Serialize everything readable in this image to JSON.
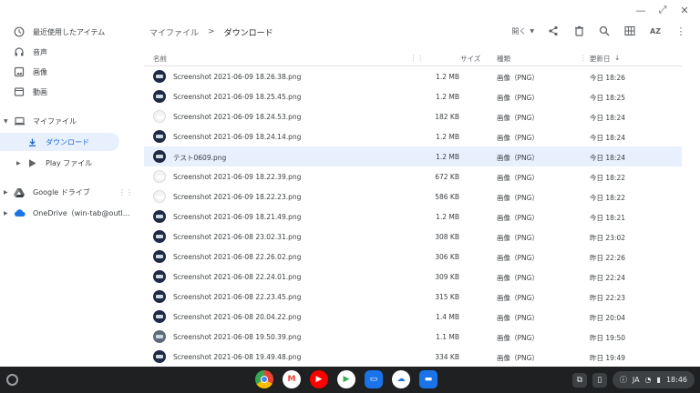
{
  "window_controls": [
    "—",
    "⤢",
    "✕"
  ],
  "sidebar": {
    "recent": "最近使用したアイテム",
    "audio": "音声",
    "images": "画像",
    "videos": "動画",
    "my_files": "マイファイル",
    "downloads": "ダウンロード",
    "play_files": "Play ファイル",
    "google_drive": "Google ドライブ",
    "onedrive": "OneDrive（win-tab@outl..."
  },
  "header": {
    "crumb_root": "マイファイル",
    "crumb_sep": ">",
    "crumb_current": "ダウンロード",
    "open_label": "開く"
  },
  "columns": {
    "name": "名前",
    "size": "サイズ",
    "type": "種類",
    "modified": "更新日"
  },
  "files": [
    {
      "name": "Screenshot 2021-06-09 18.26.38.png",
      "size": "1.2 MB",
      "type": "画像（PNG）",
      "date": "今日 18:26"
    },
    {
      "name": "Screenshot 2021-06-09 18.25.45.png",
      "size": "1.2 MB",
      "type": "画像（PNG）",
      "date": "今日 18:25"
    },
    {
      "name": "Screenshot 2021-06-09 18.24.53.png",
      "size": "182 KB",
      "type": "画像（PNG）",
      "date": "今日 18:24"
    },
    {
      "name": "Screenshot 2021-06-09 18.24.14.png",
      "size": "1.2 MB",
      "type": "画像（PNG）",
      "date": "今日 18:24"
    },
    {
      "name": "テスト0609.png",
      "size": "1.2 MB",
      "type": "画像（PNG）",
      "date": "今日 18:24"
    },
    {
      "name": "Screenshot 2021-06-09 18.22.39.png",
      "size": "672 KB",
      "type": "画像（PNG）",
      "date": "今日 18:22"
    },
    {
      "name": "Screenshot 2021-06-09 18.22.23.png",
      "size": "586 KB",
      "type": "画像（PNG）",
      "date": "今日 18:22"
    },
    {
      "name": "Screenshot 2021-06-09 18.21.49.png",
      "size": "1.2 MB",
      "type": "画像（PNG）",
      "date": "今日 18:21"
    },
    {
      "name": "Screenshot 2021-06-08 23.02.31.png",
      "size": "308 KB",
      "type": "画像（PNG）",
      "date": "昨日 23:02"
    },
    {
      "name": "Screenshot 2021-06-08 22.26.02.png",
      "size": "306 KB",
      "type": "画像（PNG）",
      "date": "昨日 22:26"
    },
    {
      "name": "Screenshot 2021-06-08 22.24.01.png",
      "size": "309 KB",
      "type": "画像（PNG）",
      "date": "昨日 22:24"
    },
    {
      "name": "Screenshot 2021-06-08 22.23.45.png",
      "size": "315 KB",
      "type": "画像（PNG）",
      "date": "昨日 22:23"
    },
    {
      "name": "Screenshot 2021-06-08 20.04.22.png",
      "size": "1.4 MB",
      "type": "画像（PNG）",
      "date": "昨日 20:04"
    },
    {
      "name": "Screenshot 2021-06-08 19.50.39.png",
      "size": "1.1 MB",
      "type": "画像（PNG）",
      "date": "昨日 19:50"
    },
    {
      "name": "Screenshot 2021-06-08 19.49.48.png",
      "size": "334 KB",
      "type": "画像（PNG）",
      "date": "昨日 19:49"
    }
  ],
  "selected_file": "テスト0609.png",
  "tray": {
    "ime": "JA",
    "time": "18:46"
  },
  "colors": {
    "accent": "#1967d2",
    "selected_bg": "#e8f0fe",
    "shelf_bg": "#1f2021"
  }
}
